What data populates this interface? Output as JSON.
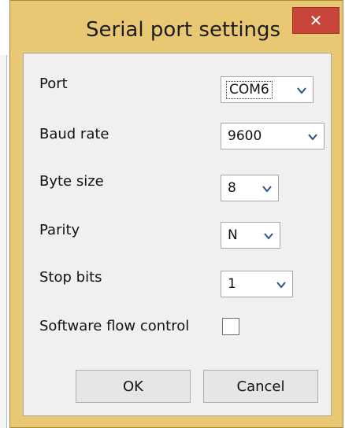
{
  "dialog": {
    "title": "Serial port settings",
    "close_icon": "close-icon",
    "close_glyph": "✕"
  },
  "fields": {
    "port": {
      "label": "Port",
      "value": "COM6"
    },
    "baud_rate": {
      "label": "Baud rate",
      "value": "9600"
    },
    "byte_size": {
      "label": "Byte size",
      "value": "8"
    },
    "parity": {
      "label": "Parity",
      "value": "N"
    },
    "stop_bits": {
      "label": "Stop bits",
      "value": "1"
    },
    "software_flow_control": {
      "label": "Software flow control",
      "checked": false
    }
  },
  "buttons": {
    "ok": "OK",
    "cancel": "Cancel"
  },
  "colors": {
    "title_bar": "#e8c872",
    "close_button": "#c9443b",
    "client_area": "#f0f0f0"
  }
}
